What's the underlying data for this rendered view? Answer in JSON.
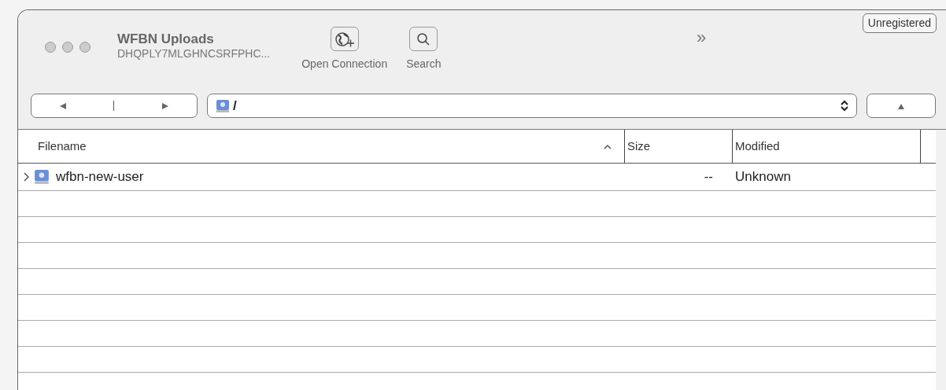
{
  "window": {
    "title": "WFBN Uploads",
    "subtitle": "DHQPLY7MLGHNCSRFPHC..."
  },
  "toolbar": {
    "buttons": [
      {
        "label": "Open Connection",
        "kind": "globe"
      },
      {
        "label": "Search",
        "kind": "search"
      }
    ],
    "overflow": "»",
    "badge": "Unregistered"
  },
  "path": {
    "value": "/"
  },
  "table": {
    "columns": [
      {
        "label": "Filename",
        "sorted": true
      },
      {
        "label": "Size",
        "sorted": false
      },
      {
        "label": "Modified",
        "sorted": false
      }
    ],
    "rows": [
      {
        "name": "wfbn-new-user",
        "size": "--",
        "modified": "Unknown",
        "expanded": false
      }
    ]
  }
}
